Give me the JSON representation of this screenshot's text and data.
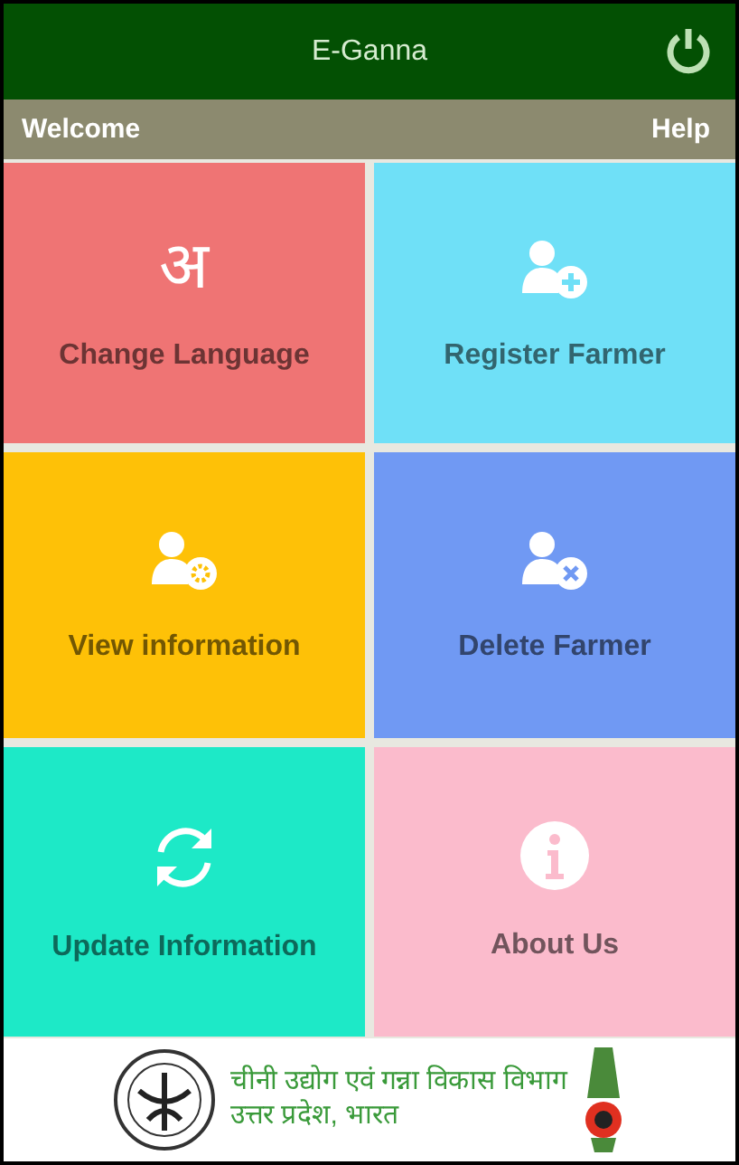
{
  "app_bar": {
    "title": "E-Ganna"
  },
  "sub_bar": {
    "left": "Welcome",
    "right": "Help"
  },
  "tiles": [
    {
      "kind": "glyph",
      "glyph": "अ",
      "label": "Change Language",
      "color": "#ef7474"
    },
    {
      "kind": "person-add",
      "label": "Register Farmer",
      "color": "#6fe0f7"
    },
    {
      "kind": "person-settings",
      "label": "View information",
      "color": "#fec107"
    },
    {
      "kind": "person-remove",
      "label": "Delete Farmer",
      "color": "#7099f3"
    },
    {
      "kind": "refresh",
      "label": "Update Information",
      "color": "#1de9c7"
    },
    {
      "kind": "info",
      "label": "About Us",
      "color": "#fbbbcc"
    }
  ],
  "footer": {
    "lines": [
      "चीनी उद्योग एवं गन्ना विकास विभाग",
      "उत्तर प्रदेश, भारत"
    ]
  }
}
